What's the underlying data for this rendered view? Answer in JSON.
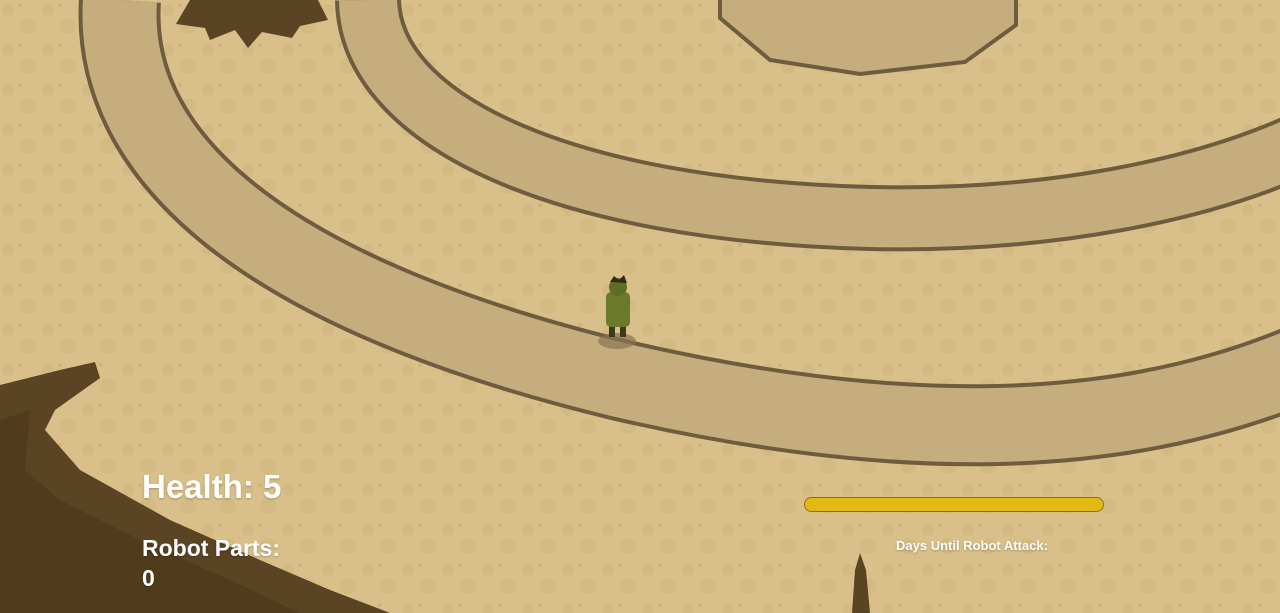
{
  "hud": {
    "health_label": "Health:",
    "health_value": "5",
    "robot_parts_label": "Robot Parts:",
    "robot_parts_value": "0",
    "days_label": "Days Until Robot Attack:",
    "days_progress": 1.0
  },
  "world": {
    "player_sprite": "green-goblin-character",
    "colors": {
      "ground": "#d9c08a",
      "path": "#c6ad7e",
      "path_outline": "#6f5b3e",
      "tree": "#5a4423",
      "bar": "#e2b812"
    }
  }
}
